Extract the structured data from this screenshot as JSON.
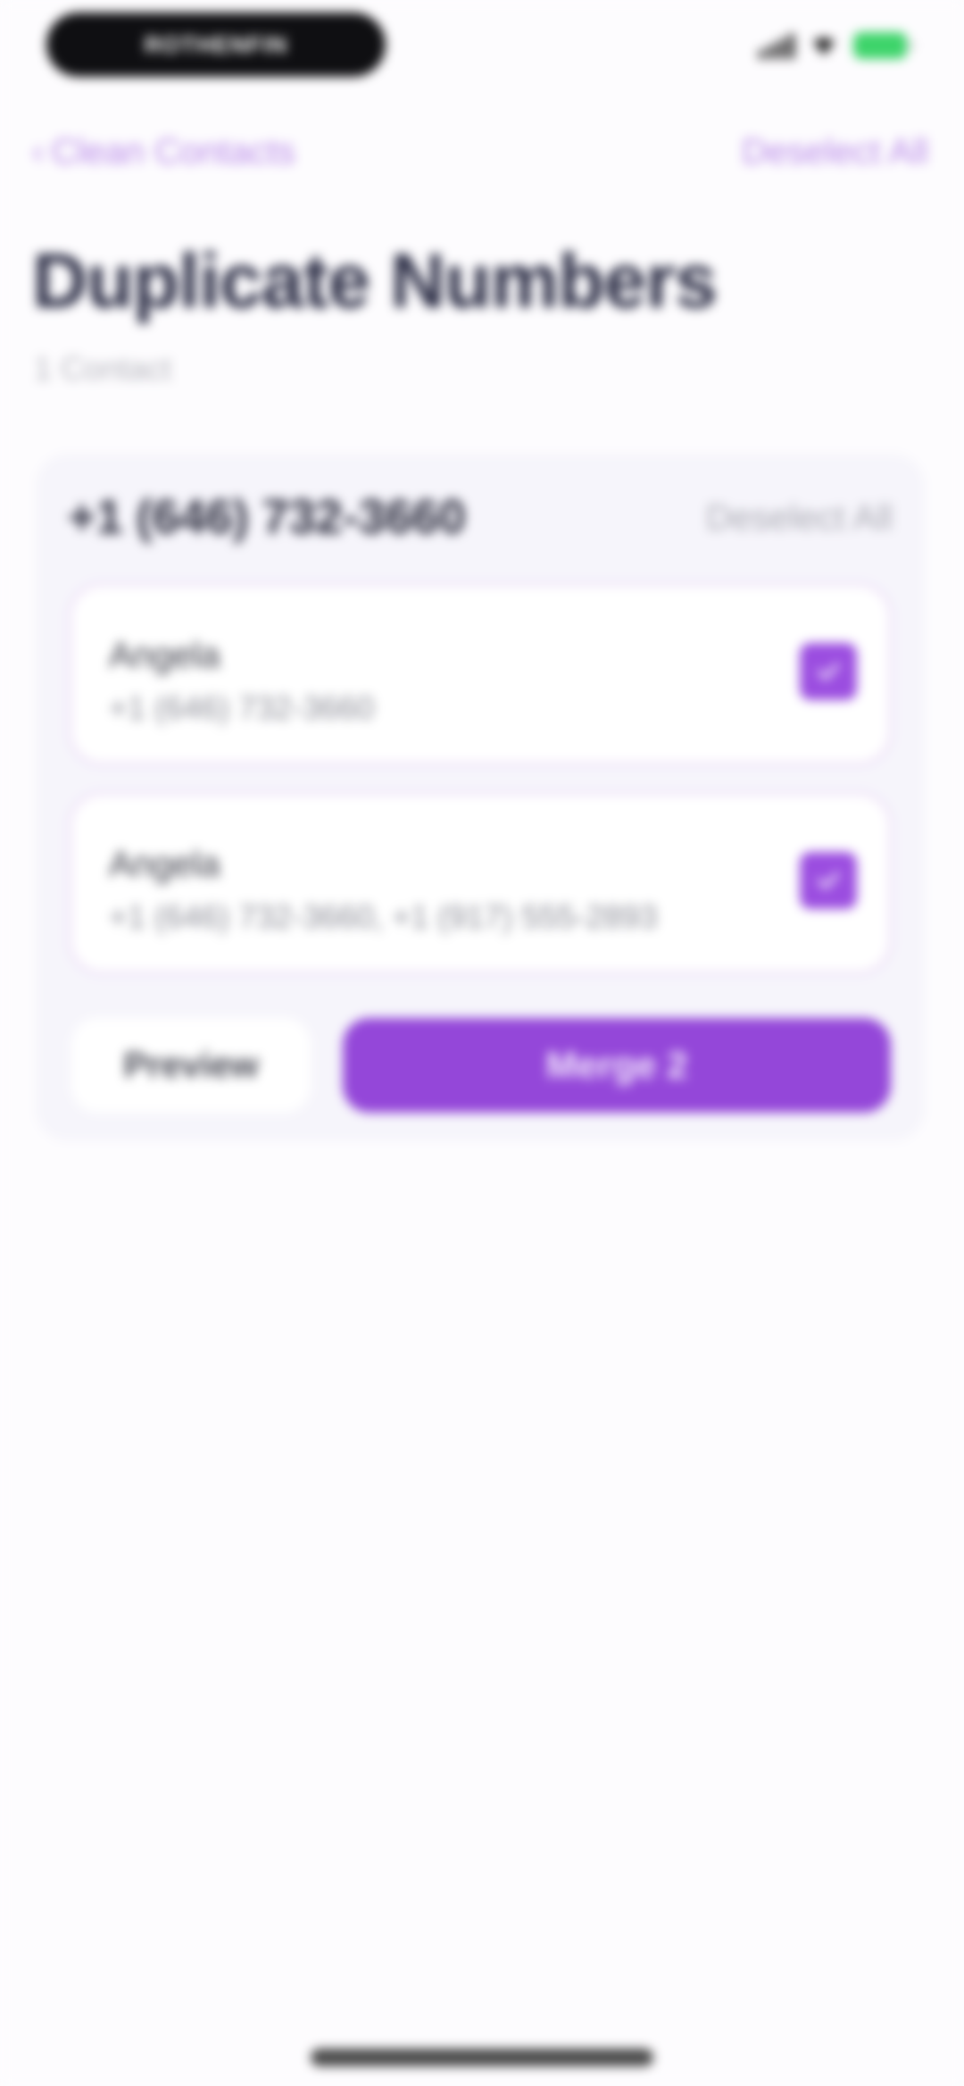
{
  "status_bar": {
    "pill_text": "ROTHENFIN",
    "battery_color": "#3dd46a"
  },
  "nav": {
    "back_label": "Clean Contacts",
    "right_label": "Deselect All"
  },
  "header": {
    "title": "Duplicate Numbers",
    "subtitle": "1 Contact"
  },
  "group": {
    "number": "+1 (646) 732-3660",
    "deselect_label": "Deselect All",
    "contacts": [
      {
        "name": "Angela",
        "phone": "+1 (646) 732-3660",
        "selected": true
      },
      {
        "name": "Angela",
        "phone": "+1 (646) 732-3660, +1 (917) 555-2893",
        "selected": true
      }
    ],
    "preview_label": "Preview",
    "merge_label": "Merge 2"
  },
  "colors": {
    "accent": "#9447d9",
    "accent_light": "#b889e8",
    "title": "#2b2d45"
  }
}
